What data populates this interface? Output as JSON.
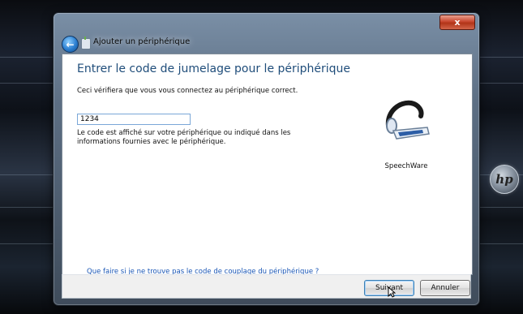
{
  "window": {
    "title": "Ajouter un périphérique",
    "close_label": "x"
  },
  "content": {
    "heading": "Entrer le code de jumelage pour le périphérique",
    "description": "Ceci vérifiera que vous vous connectez au périphérique correct.",
    "code_input_value": "1234",
    "hint_line1": "Le code est affiché sur votre périphérique ou indiqué dans les",
    "hint_line2": "informations fournies avec le périphérique.",
    "device_name": "SpeechWare",
    "help_link": "Que faire si je ne trouve pas le code de couplage du périphérique ?"
  },
  "footer": {
    "next_label": "Suivant",
    "cancel_label": "Annuler"
  },
  "colors": {
    "heading": "#1f4d7a",
    "link": "#1a56b5",
    "close_button": "#c8462e"
  },
  "icons": {
    "back": "back-arrow-icon",
    "bluetooth": "bluetooth-device-icon",
    "device": "headset-icon",
    "hp": "hp-logo"
  }
}
